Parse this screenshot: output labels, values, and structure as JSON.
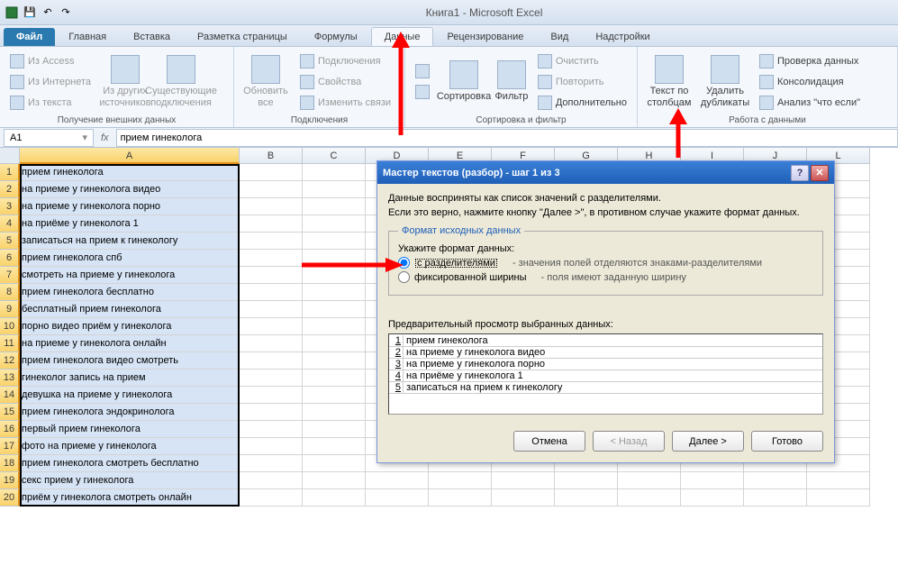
{
  "app_title": "Книга1 - Microsoft Excel",
  "tabs": {
    "file": "Файл",
    "home": "Главная",
    "insert": "Вставка",
    "page": "Разметка страницы",
    "formulas": "Формулы",
    "data": "Данные",
    "review": "Рецензирование",
    "view": "Вид",
    "addins": "Надстройки"
  },
  "ribbon": {
    "group_external": {
      "label": "Получение внешних данных",
      "access": "Из Access",
      "web": "Из Интернета",
      "text": "Из текста",
      "other": "Из других источников",
      "existing": "Существующие подключения"
    },
    "group_conn": {
      "label": "Подключения",
      "refresh": "Обновить все",
      "connections": "Подключения",
      "properties": "Свойства",
      "editlinks": "Изменить связи"
    },
    "group_sort": {
      "label": "Сортировка и фильтр",
      "sort": "Сортировка",
      "filter": "Фильтр",
      "clear": "Очистить",
      "reapply": "Повторить",
      "advanced": "Дополнительно"
    },
    "group_tools": {
      "label": "Работа с данными",
      "t2c": "Текст по столбцам",
      "dedup": "Удалить дубликаты",
      "validate": "Проверка данных",
      "consolidate": "Консолидация",
      "whatif": "Анализ \"что если\""
    }
  },
  "namebox": "A1",
  "formula_value": "прием гинеколога",
  "columns": [
    "A",
    "B",
    "C",
    "D",
    "E",
    "F",
    "G",
    "H",
    "I",
    "J",
    "L"
  ],
  "rows": {
    "1": "прием гинеколога",
    "2": "на приеме у гинеколога видео",
    "3": "на приеме у гинеколога порно",
    "4": "на приёме у гинеколога 1",
    "5": "записаться на прием к гинекологу",
    "6": "прием гинеколога спб",
    "7": "смотреть на приеме у гинеколога",
    "8": "прием гинеколога бесплатно",
    "9": "бесплатный прием гинеколога",
    "10": "порно видео приём у гинеколога",
    "11": "на приеме у гинеколога онлайн",
    "12": "прием гинеколога видео смотреть",
    "13": "гинеколог запись на прием",
    "14": "девушка на приеме у гинеколога",
    "15": "прием гинеколога эндокринолога",
    "16": "первый прием гинеколога",
    "17": "фото на приеме у гинеколога",
    "18": "прием гинеколога смотреть бесплатно",
    "19": "секс прием у гинеколога",
    "20": "приём у гинеколога смотреть онлайн"
  },
  "dialog": {
    "title": "Мастер текстов (разбор) - шаг 1 из 3",
    "line1": "Данные восприняты как список значений с разделителями.",
    "line2": "Если это верно, нажмите кнопку \"Далее >\", в противном случае укажите формат данных.",
    "legend": "Формат исходных данных",
    "specify": "Укажите формат данных:",
    "opt_delim": "с разделителями",
    "opt_delim_desc": "- значения полей отделяются знаками-разделителями",
    "opt_fixed": "фиксированной ширины",
    "opt_fixed_desc": "- поля имеют заданную ширину",
    "preview_label": "Предварительный просмотр выбранных данных:",
    "preview": [
      {
        "n": "1",
        "t": "прием гинеколога"
      },
      {
        "n": "2",
        "t": "на приеме у гинеколога видео"
      },
      {
        "n": "3",
        "t": "на приеме у гинеколога порно"
      },
      {
        "n": "4",
        "t": "на приёме у гинеколога 1"
      },
      {
        "n": "5",
        "t": "записаться на прием к гинекологу"
      }
    ],
    "btn_cancel": "Отмена",
    "btn_back": "< Назад",
    "btn_next": "Далее >",
    "btn_finish": "Готово"
  }
}
